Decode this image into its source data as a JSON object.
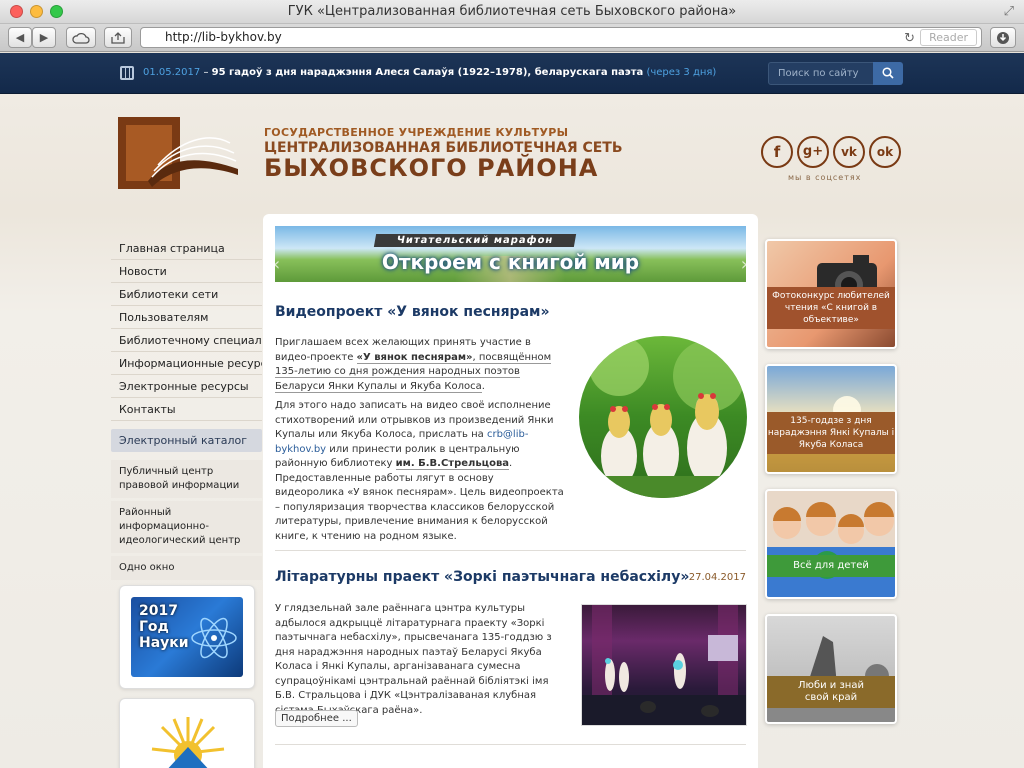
{
  "window": {
    "title": "ГУК «Централизованная библиотечная сеть Быховского района»"
  },
  "browser": {
    "url": "http://lib-bykhov.by",
    "reader_label": "Reader"
  },
  "topbar": {
    "date": "01.05.2017",
    "separator": " – ",
    "event": "95 гадоў з дня нараджэння Алеся Салаўя (1922–1978), беларускага паэта",
    "soon": "(через 3 дня)",
    "search_placeholder": "Поиск по сайту"
  },
  "header": {
    "org_line1": "ГОСУДАРСТВЕННОЕ УЧРЕЖДЕНИЕ КУЛЬТУРЫ",
    "org_line2": "ЦЕНТРАЛИЗОВАННАЯ БИБЛИОТЕЧНАЯ СЕТЬ",
    "org_line3": "БЫХОВСКОГО РАЙОНА",
    "social": [
      {
        "icon": "facebook-icon",
        "glyph": "f"
      },
      {
        "icon": "googleplus-icon",
        "glyph": "g+"
      },
      {
        "icon": "vk-icon",
        "glyph": "vk"
      },
      {
        "icon": "odnoklassniki-icon",
        "glyph": "ok"
      }
    ],
    "social_caption": "мы в соцсетях"
  },
  "nav": {
    "items": [
      "Главная страница",
      "Новости",
      "Библиотеки сети",
      "Пользователям",
      "Библиотечному специалисту",
      "Информационные ресурсы",
      "Электронные ресурсы",
      "Контакты"
    ],
    "catalog": "Электронный каталог",
    "sub": [
      "Публичный центр правовой информации",
      "Районный информационно-идеологический центр",
      "Одно окно"
    ],
    "banner1_line1": "2017",
    "banner1_line2": "Год",
    "banner1_line3": "Науки"
  },
  "slider": {
    "header": "Читательский марафон",
    "text": "Откроем с книгой мир"
  },
  "articles": [
    {
      "title": "Видеопроект «У вянок песнярам»",
      "p1_a": "Приглашаем всех желающих принять участие в видео-проекте ",
      "p1_b": "«У вянок песнярам»",
      "p1_c": ", посвящённом 135-летию со дня рождения народных поэтов Беларуси Янки Купалы и Якуба Колоса",
      "p1_d": ".",
      "p2_a": "Для этого надо записать на видео своё исполнение стихотворений или отрывков из произведений Янки Купалы или Якуба Колоса, прислать на ",
      "p2_email": "crb@lib-bykhov.by",
      "p2_b": " или принести ролик в центральную районную библиотеку ",
      "p2_c": "им. Б.В.Стрельцова",
      "p2_d": ". Предоставленные работы лягут в основу видеоролика «У вянок песнярам». Цель видеопроекта – популяризация творчества классиков белорусской литературы, привлечение внимания к белорусской книге, к чтению на родном языке."
    },
    {
      "title": "Літаратурны праект «Зоркі паэтычнага небасхілу»",
      "date": "27.04.2017",
      "text": "У глядзельнай зале раённага цэнтра культуры адбылося адкрыццё літаратурнага праекту «Зоркі паэтычнага небасхілу», прысвечанага 135-годдзю з дня нараджэння народных паэтаў Беларусі Якуба Коласа і Янкі Купалы, арганізаванага сумесна супрацоўнікамі цэнтральнай раённай бібліятэкі імя Б.В. Стральцова і ДУК «Цэнтралізаваная клубная сістэма Быхаўскага раёна».",
      "more": "Подробнее ..."
    }
  ],
  "right_banners": [
    {
      "caption": "Фотоконкурс любителей чтения «С книгой в объективе»",
      "color": "#a0522d"
    },
    {
      "caption": "135-годдзе з дня нараджэння Янкі Купалы і Якуба Коласа",
      "color": "#9a5a2a"
    },
    {
      "caption": "Всё для детей",
      "color": "#3e9a3a"
    },
    {
      "caption": "Люби и знай свой край",
      "color": "#8a6a2a"
    }
  ]
}
